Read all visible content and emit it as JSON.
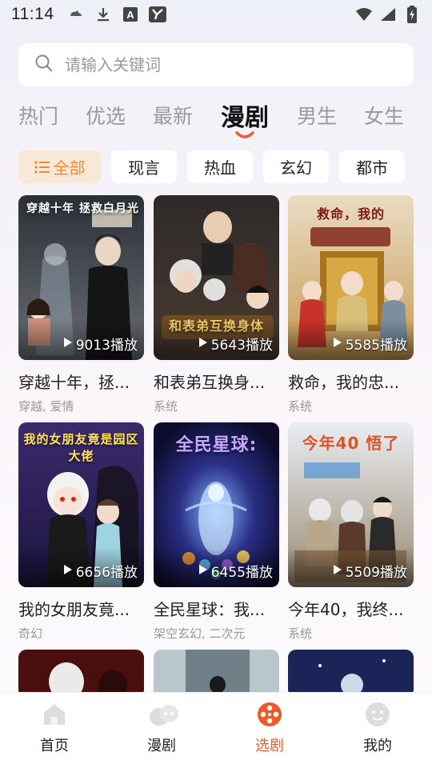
{
  "status_bar": {
    "time": "11:14",
    "left_icons": [
      "cat-icon",
      "download-icon",
      "a-app-icon",
      "y-app-icon"
    ],
    "right_icons": [
      "wifi-icon",
      "signal-icon",
      "battery-charging-icon"
    ]
  },
  "search": {
    "placeholder": "请输入关键词"
  },
  "top_tabs": [
    {
      "label": "热门",
      "active": false
    },
    {
      "label": "优选",
      "active": false
    },
    {
      "label": "最新",
      "active": false
    },
    {
      "label": "漫剧",
      "active": true
    },
    {
      "label": "男生",
      "active": false
    },
    {
      "label": "女生",
      "active": false
    }
  ],
  "chips": [
    {
      "label": "全部",
      "active": true,
      "icon": "list-icon"
    },
    {
      "label": "现言",
      "active": false
    },
    {
      "label": "热血",
      "active": false
    },
    {
      "label": "玄幻",
      "active": false
    },
    {
      "label": "都市",
      "active": false
    }
  ],
  "cards": [
    {
      "title": "穿越十年，拯...",
      "tags": "穿越, 爱情",
      "plays": "9013播放",
      "cover_text": "穿越十年 拯救白月光"
    },
    {
      "title": "和表弟互换身...",
      "tags": "系统",
      "plays": "5643播放",
      "cover_text": "和表弟互换身体"
    },
    {
      "title": "救命，我的忠...",
      "tags": "系统",
      "plays": "5585播放",
      "cover_text": "救命，我的"
    },
    {
      "title": "我的女朋友竟...",
      "tags": "奇幻",
      "plays": "6656播放",
      "cover_text": "我的女朋友竟是园区大佬"
    },
    {
      "title": "全民星球：我...",
      "tags": "架空玄幻, 二次元",
      "plays": "6455播放",
      "cover_text": "全民星球:"
    },
    {
      "title": "今年40，我终...",
      "tags": "系统",
      "plays": "5509播放",
      "cover_text": "今年40 悟了"
    },
    {
      "title": "",
      "tags": "",
      "plays": "",
      "cover_text": ""
    },
    {
      "title": "",
      "tags": "",
      "plays": "",
      "cover_text": ""
    },
    {
      "title": "",
      "tags": "",
      "plays": "",
      "cover_text": ""
    }
  ],
  "bottom_nav": [
    {
      "label": "首页",
      "icon": "home-icon",
      "active": false
    },
    {
      "label": "漫剧",
      "icon": "comic-icon",
      "active": false
    },
    {
      "label": "选剧",
      "icon": "film-reel-icon",
      "active": true
    },
    {
      "label": "我的",
      "icon": "profile-icon",
      "active": false
    }
  ],
  "colors": {
    "accent": "#ee8a2c",
    "nav_active": "#ee5a2a",
    "tab_indicator": "#ee5a2a"
  }
}
